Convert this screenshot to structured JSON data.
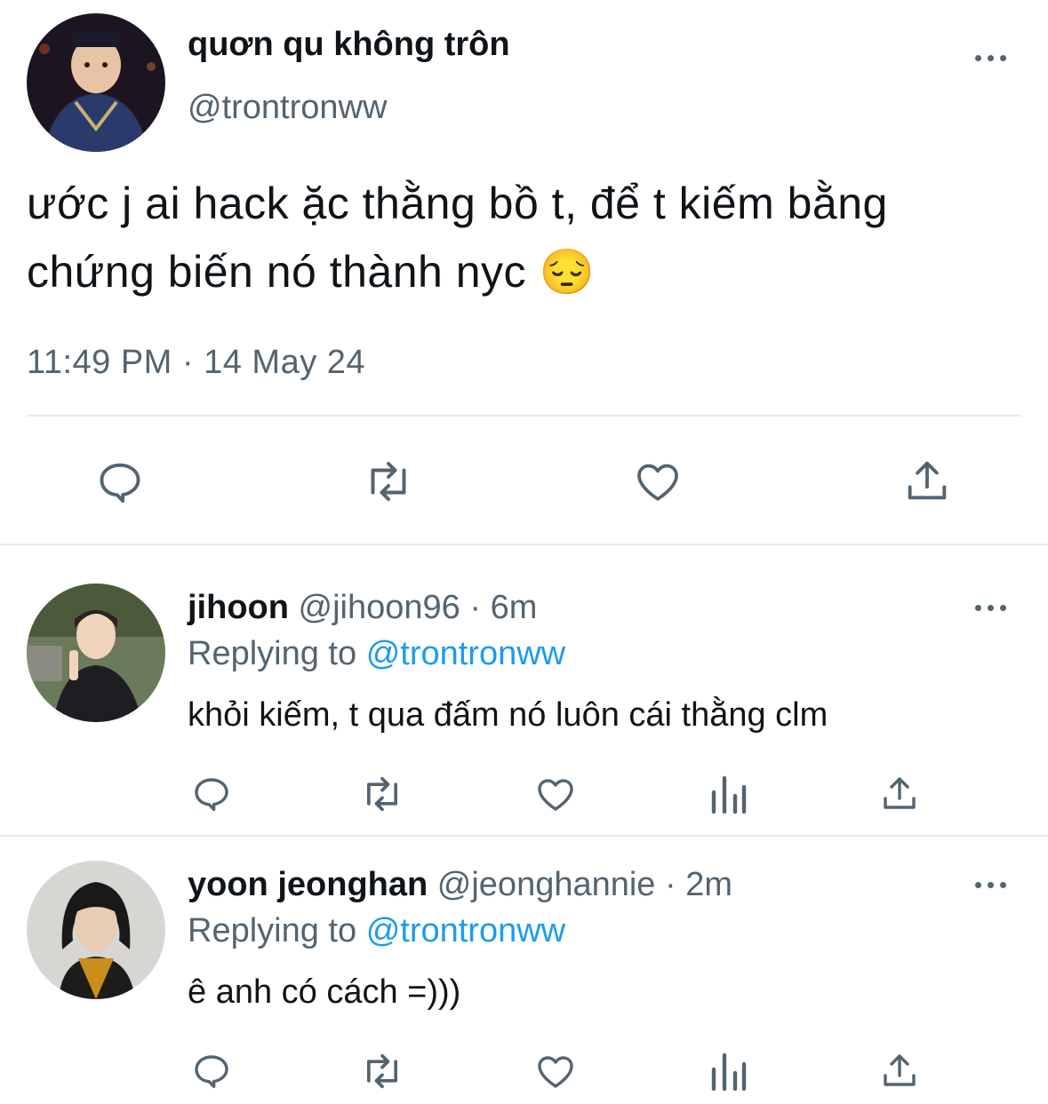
{
  "main_tweet": {
    "display_name": "quơn qu không trôn",
    "handle": "@trontronww",
    "text_line1": "ước j ai hack ặc thằng bồ t, để t kiếm bằng",
    "text_line2": "chứng biến nó thành nyc",
    "emoji": "😔",
    "timestamp": "11:49 PM · 14 May 24",
    "actions": [
      "reply-icon",
      "retweet-icon",
      "like-icon",
      "share-icon"
    ]
  },
  "replies": [
    {
      "display_name": "jihoon",
      "meta": "@jihoon96 · 6m",
      "replying_prefix": "Replying to",
      "replying_handle": "@trontronww",
      "text": "khỏi kiếm, t qua đấm nó luôn cái thằng clm",
      "actions": [
        "reply-icon",
        "retweet-icon",
        "like-icon",
        "analytics-icon",
        "share-icon"
      ]
    },
    {
      "display_name": "yoon jeonghan",
      "meta": "@jeonghannie · 2m",
      "replying_prefix": "Replying to",
      "replying_handle": "@trontronww",
      "text": "ê anh có cách =)))",
      "actions": [
        "reply-icon",
        "retweet-icon",
        "like-icon",
        "analytics-icon",
        "share-icon"
      ]
    }
  ],
  "colors": {
    "text": "#0f1419",
    "secondary": "#536471",
    "link": "#1d9bf0",
    "divider": "#e7e9ea"
  }
}
